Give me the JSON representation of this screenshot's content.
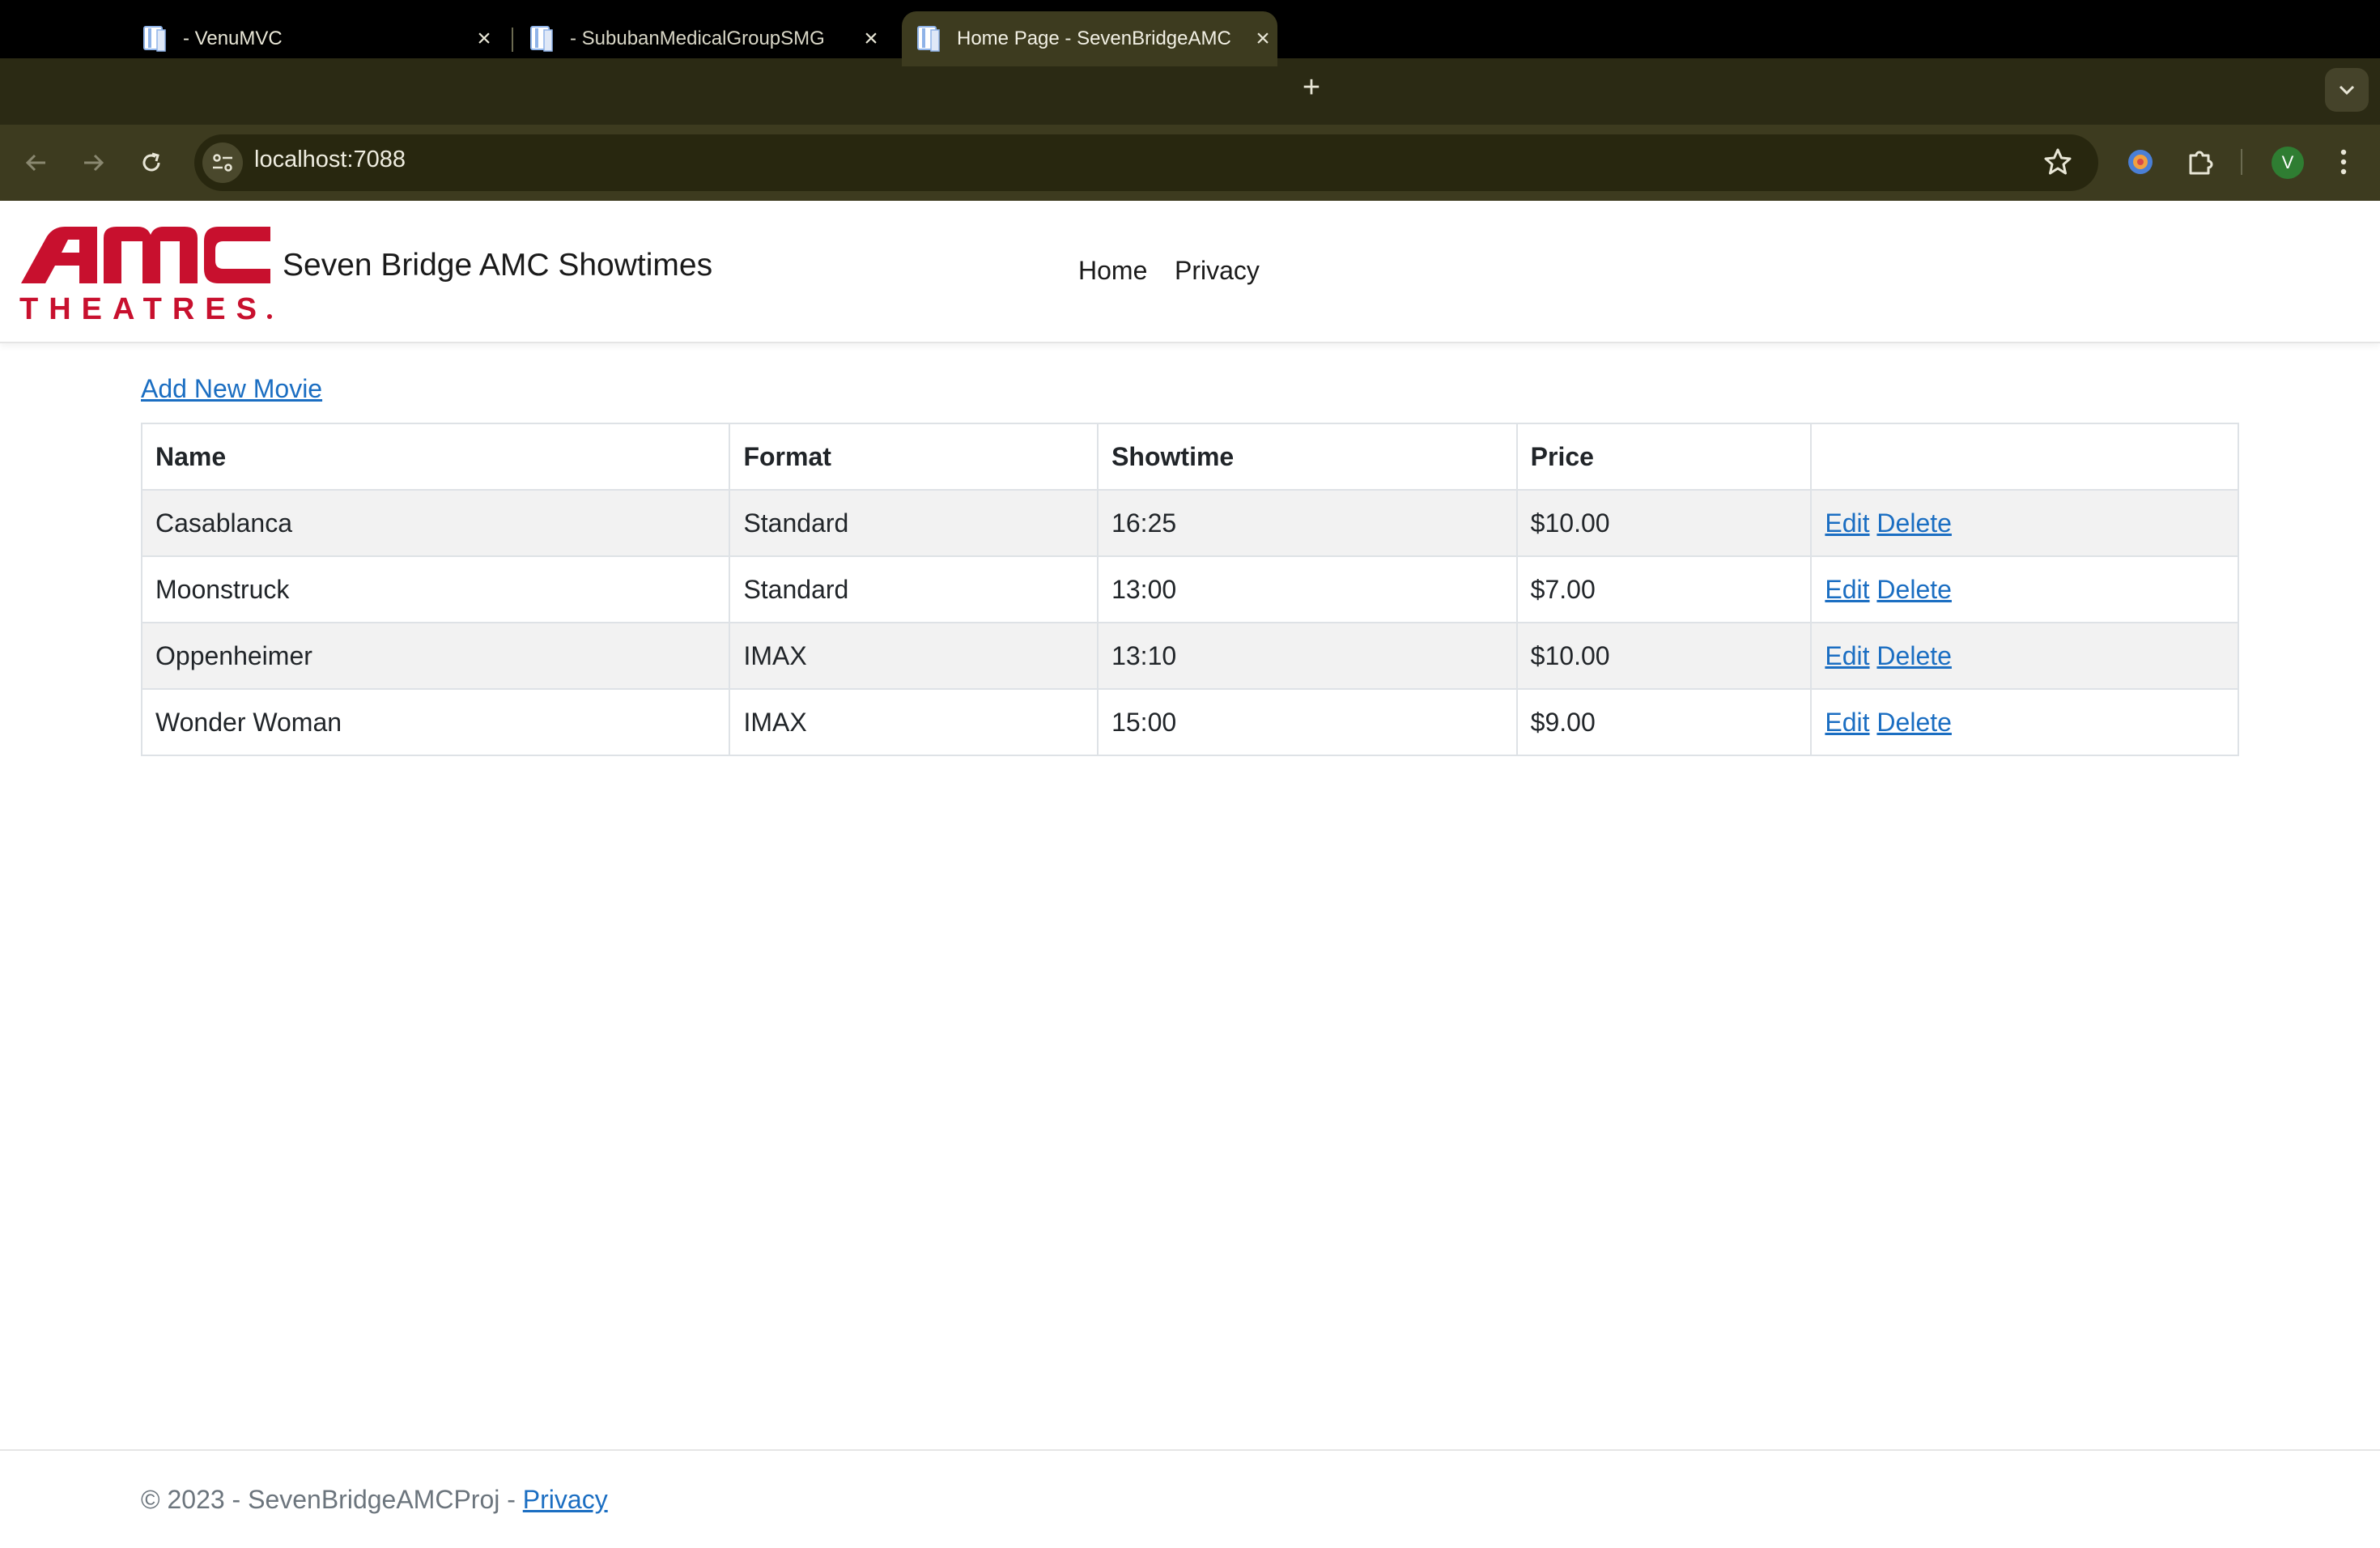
{
  "browser": {
    "tabs": [
      {
        "title": "- VenuMVC",
        "active": false
      },
      {
        "title": "- SububanMedicalGroupSMG",
        "active": false
      },
      {
        "title": "Home Page - SevenBridgeAMC",
        "active": true
      }
    ],
    "url": "localhost:7088",
    "profile_initial": "V",
    "icons": {
      "back": "arrow-left-icon",
      "forward": "arrow-right-icon",
      "reload": "reload-icon",
      "site_info": "tune-icon",
      "bookmark": "star-icon",
      "extension": "puzzle-icon",
      "menu": "kebab-menu-icon",
      "new_tab": "plus-icon",
      "tab_search": "chevron-down-icon",
      "favicon": "document-icon",
      "close": "close-icon"
    }
  },
  "header": {
    "logo_text_top": "amc",
    "logo_text_bottom": "THEATRES",
    "brand": "Seven Bridge AMC Showtimes",
    "nav": [
      {
        "label": "Home"
      },
      {
        "label": "Privacy"
      }
    ]
  },
  "main": {
    "add_link": "Add New Movie",
    "table": {
      "columns": [
        "Name",
        "Format",
        "Showtime",
        "Price",
        ""
      ],
      "rows": [
        {
          "name": "Casablanca",
          "format": "Standard",
          "showtime": "16:25",
          "price": "$10.00",
          "edit": "Edit",
          "delete": "Delete"
        },
        {
          "name": "Moonstruck",
          "format": "Standard",
          "showtime": "13:00",
          "price": "$7.00",
          "edit": "Edit",
          "delete": "Delete"
        },
        {
          "name": "Oppenheimer",
          "format": "IMAX",
          "showtime": "13:10",
          "price": "$10.00",
          "edit": "Edit",
          "delete": "Delete"
        },
        {
          "name": "Wonder Woman",
          "format": "IMAX",
          "showtime": "15:00",
          "price": "$9.00",
          "edit": "Edit",
          "delete": "Delete"
        }
      ]
    }
  },
  "footer": {
    "text": "© 2023 - SevenBridgeAMCProj - ",
    "link": "Privacy"
  },
  "colors": {
    "amc_red": "#c8102e",
    "link_blue": "#1b6ec2",
    "chrome_bg": "#3d3b1f",
    "tabstrip_bg": "#2b2a14"
  }
}
